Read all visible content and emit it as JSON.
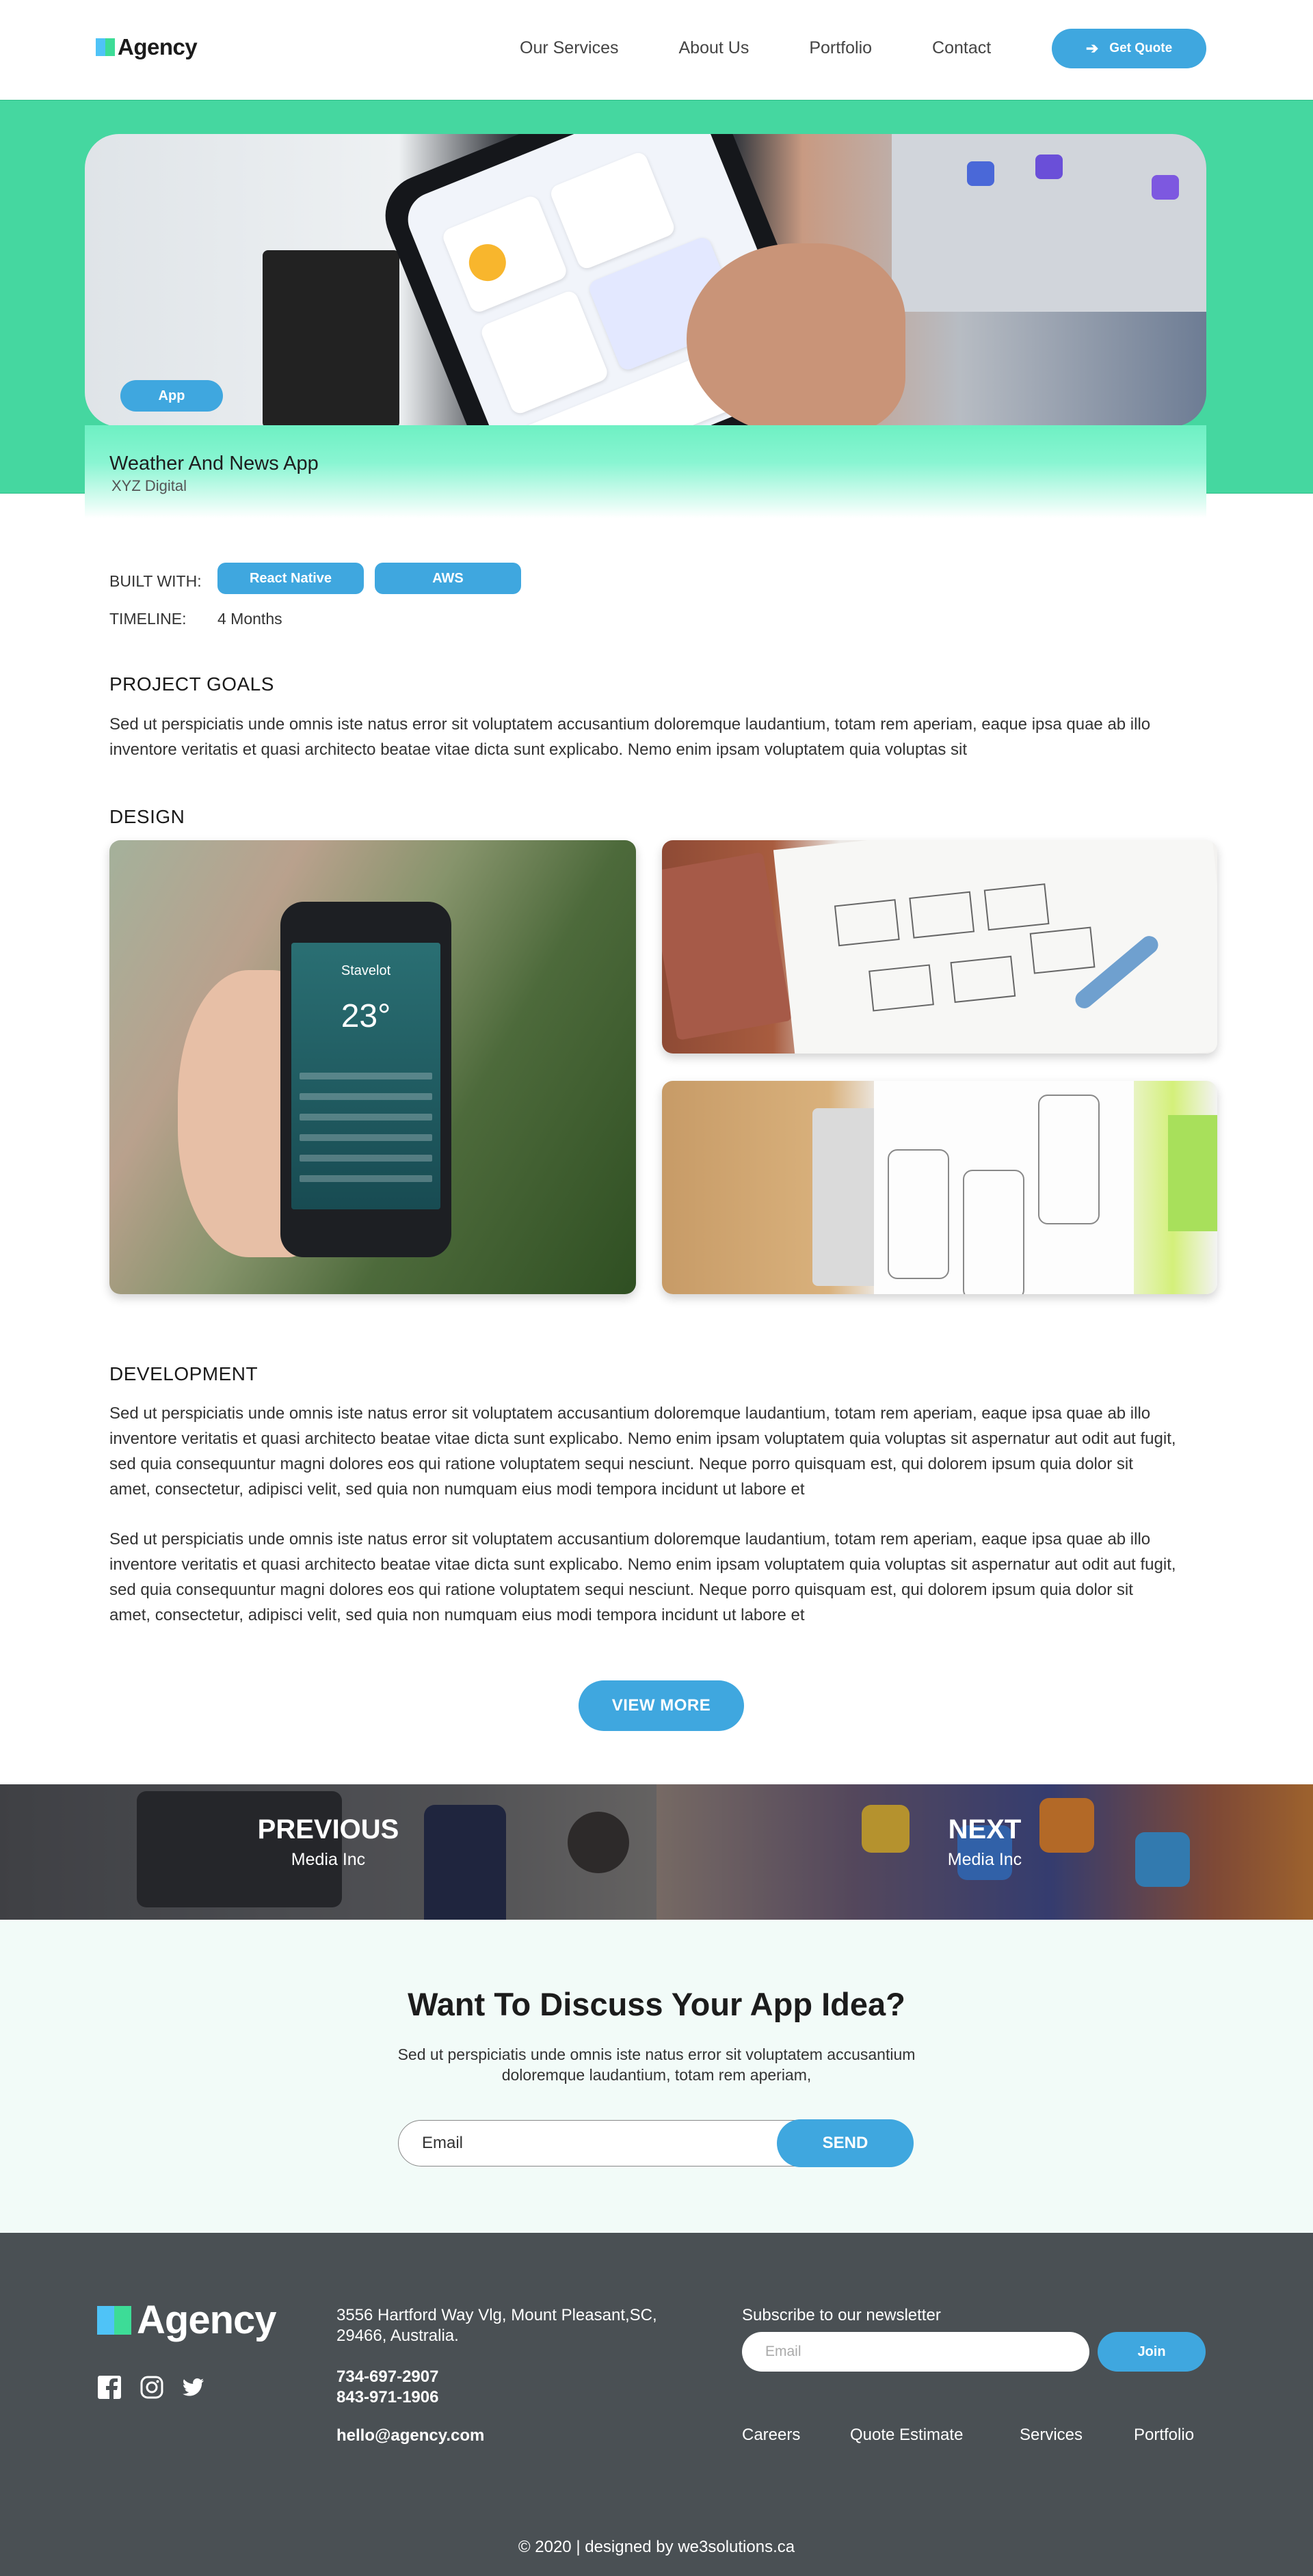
{
  "header": {
    "logo": "Agency",
    "nav": [
      "Our Services",
      "About Us",
      "Portfolio",
      "Contact"
    ],
    "cta_label": "Get Quote"
  },
  "hero": {
    "badge": "App",
    "title": "Weather And News App",
    "client": "XYZ Digital"
  },
  "meta": {
    "built_with_label": "BUILT WITH:",
    "tech": [
      "React Native",
      "AWS"
    ],
    "timeline_label": "TIMELINE:",
    "timeline_value": "4 Months"
  },
  "goals": {
    "heading": "PROJECT GOALS",
    "text": "Sed ut perspiciatis unde omnis iste natus error sit voluptatem accusantium doloremque laudantium, totam rem aperiam, eaque ipsa quae ab illo inventore veritatis et quasi architecto beatae vitae dicta sunt explicabo. Nemo enim ipsam voluptatem quia voluptas sit"
  },
  "design": {
    "heading": "DESIGN",
    "phone_city": "Stavelot",
    "phone_temp": "23°"
  },
  "development": {
    "heading": "DEVELOPMENT",
    "paragraphs": [
      "Sed ut perspiciatis unde omnis iste natus error sit voluptatem accusantium doloremque laudantium, totam rem aperiam, eaque ipsa quae ab illo inventore veritatis et quasi architecto beatae vitae dicta sunt explicabo. Nemo enim ipsam voluptatem quia voluptas sit aspernatur aut odit aut fugit, sed quia consequuntur magni dolores eos qui ratione voluptatem sequi nesciunt. Neque porro quisquam est, qui dolorem ipsum quia dolor sit amet, consectetur, adipisci velit, sed quia non numquam eius modi tempora incidunt ut labore et",
      "Sed ut perspiciatis unde omnis iste natus error sit voluptatem accusantium doloremque laudantium, totam rem aperiam, eaque ipsa quae ab illo inventore veritatis et quasi architecto beatae vitae dicta sunt explicabo. Nemo enim ipsam voluptatem quia voluptas sit aspernatur aut odit aut fugit, sed quia consequuntur magni dolores eos qui ratione voluptatem sequi nesciunt. Neque porro quisquam est, qui dolorem ipsum quia dolor sit amet, consectetur, adipisci velit, sed quia non numquam eius modi tempora incidunt ut labore et"
    ],
    "view_more": "VIEW MORE"
  },
  "pager": {
    "prev_label": "PREVIOUS",
    "prev_name": "Media Inc",
    "next_label": "NEXT",
    "next_name": "Media Inc"
  },
  "cta": {
    "title": "Want To Discuss Your App Idea?",
    "text": "Sed ut perspiciatis unde omnis iste natus error sit voluptatem accusantium doloremque laudantium, totam rem aperiam,",
    "email_placeholder": "Email",
    "send": "SEND"
  },
  "footer": {
    "logo": "Agency",
    "address": "3556 Hartford Way Vlg, Mount Pleasant,SC, 29466, Australia.",
    "phone1": "734-697-2907",
    "phone2": "843-971-1906",
    "email": "hello@agency.com",
    "newsletter_label": "Subscribe to our newsletter",
    "newsletter_placeholder": "Email",
    "join": "Join",
    "links": [
      "Careers",
      "Quote Estimate",
      "Services",
      "Portfolio"
    ],
    "copyright": "© 2020 | designed by we3solutions.ca"
  },
  "colors": {
    "accent": "#3fa7df",
    "hero_green": "#45d7a0",
    "footer_bg": "#4a5054",
    "cta_bg": "#f2fbf8"
  }
}
